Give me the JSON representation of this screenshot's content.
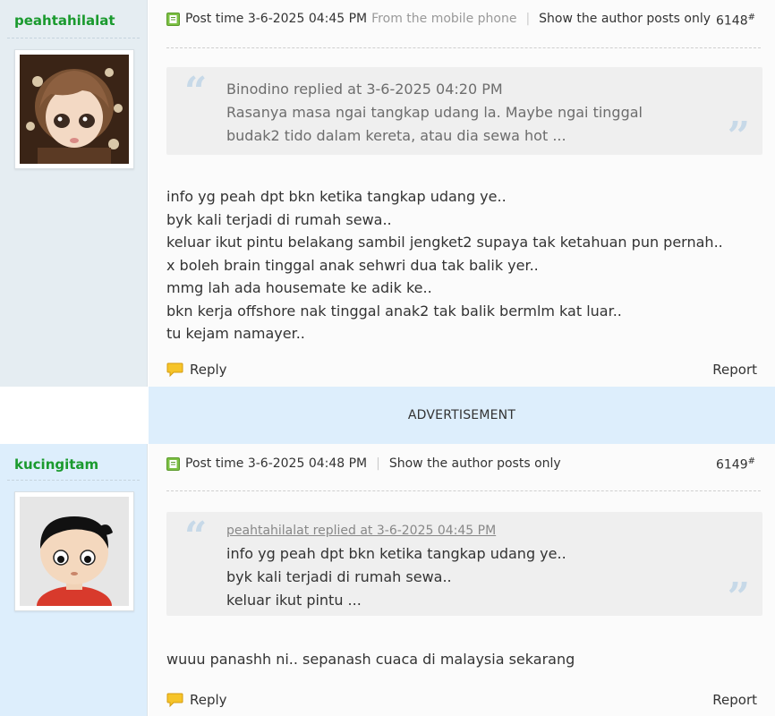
{
  "posts": [
    {
      "author": "peahtahilalat",
      "avatar_icon": "doll-avatar-icon",
      "post_time": "Post time 3-6-2025 04:45 PM",
      "source": "From the mobile phone",
      "author_only": "Show the author posts only",
      "floor": "6148",
      "floor_mark": "#",
      "quote": {
        "meta": "Binodino replied at 3-6-2025 04:20 PM",
        "lines": [
          "Rasanya masa ngai tangkap udang la. Maybe ngai tinggal",
          "budak2 tido dalam kereta, atau dia sewa hot ..."
        ]
      },
      "body": [
        "info yg peah dpt bkn ketika tangkap udang ye..",
        "byk kali terjadi di rumah sewa..",
        "keluar ikut pintu belakang sambil jengket2 supaya tak ketahuan pun pernah..",
        "x boleh brain tinggal anak sehwri dua tak balik yer..",
        "mmg lah ada housemate ke adik ke..",
        "bkn kerja offshore nak tinggal anak2 tak balik bermlm kat luar..",
        "tu kejam namayer.."
      ],
      "reply": "Reply",
      "report": "Report"
    },
    {
      "author": "kucingitam",
      "avatar_icon": "cartoon-avatar-icon",
      "post_time": "Post time 3-6-2025 04:48 PM",
      "author_only": "Show the author posts only",
      "floor": "6149",
      "floor_mark": "#",
      "quote": {
        "meta": "peahtahilalat replied at 3-6-2025 04:45 PM",
        "lines": [
          "info yg peah dpt bkn ketika tangkap udang ye..",
          "byk kali terjadi di rumah sewa..",
          "keluar ikut pintu  ..."
        ]
      },
      "body": [
        "wuuu panashh ni.. sepanash cuaca di malaysia sekarang"
      ],
      "reply": "Reply",
      "report": "Report"
    }
  ],
  "advertisement": "ADVERTISEMENT",
  "colors": {
    "author_green": "#1a9a2e",
    "side_grey": "#e5edf2",
    "side_blue": "#ddeefc",
    "quote_bg": "#efefef",
    "quote_mark": "#c7d9e8"
  }
}
